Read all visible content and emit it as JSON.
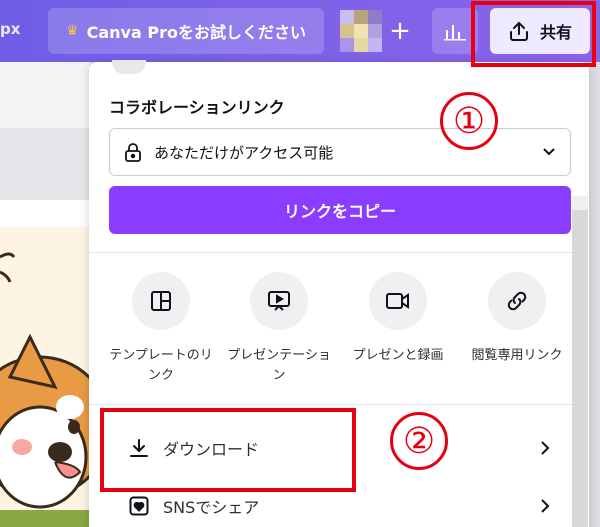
{
  "topbar": {
    "size_label": "px",
    "pro_button": "Canva Proをお試しください",
    "crown_icon": "crown-icon",
    "plus_label": "+",
    "share_label": "共有"
  },
  "panel": {
    "collab_title": "コラボレーションリンク",
    "access_value": "あなただけがアクセス可能",
    "copy_link_label": "リンクをコピー",
    "options": [
      {
        "icon": "template-icon",
        "label": "テンプレートのリンク"
      },
      {
        "icon": "presentation-icon",
        "label": "プレゼンテーション"
      },
      {
        "icon": "video-record-icon",
        "label": "プレゼンと録画"
      },
      {
        "icon": "link-icon",
        "label": "閲覧専用リンク"
      }
    ],
    "download_label": "ダウンロード",
    "sns_label": "SNSでシェア"
  },
  "annotations": {
    "num1": "①",
    "num2": "②",
    "color": "#e60012"
  },
  "colors": {
    "accent": "#8b3dff",
    "topbar": "#7b61e8"
  }
}
